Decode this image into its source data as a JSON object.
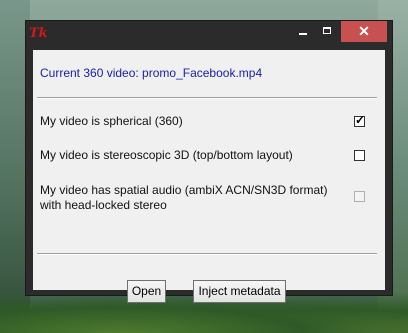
{
  "window": {
    "app_icon": "tk-feather-icon",
    "app_icon_text": "Tk",
    "controls": {
      "minimize": "minimize",
      "maximize": "maximize",
      "close": "✕"
    }
  },
  "main": {
    "current_video_text": "Current 360 video: promo_Facebook.mp4",
    "options": [
      {
        "label": "My video is spherical (360)",
        "checked": true,
        "enabled": true
      },
      {
        "label": "My video is stereoscopic 3D (top/bottom layout)",
        "checked": false,
        "enabled": true
      },
      {
        "label_line1": "My video has spatial audio (ambiX ACN/SN3D format)",
        "label_line2": "with head-locked stereo",
        "checked": false,
        "enabled": false
      }
    ],
    "buttons": {
      "open": "Open",
      "inject": "Inject metadata"
    }
  },
  "colors": {
    "accent_text": "#1a20b0",
    "close_button": "#c75050",
    "tk_icon": "#d01818"
  }
}
